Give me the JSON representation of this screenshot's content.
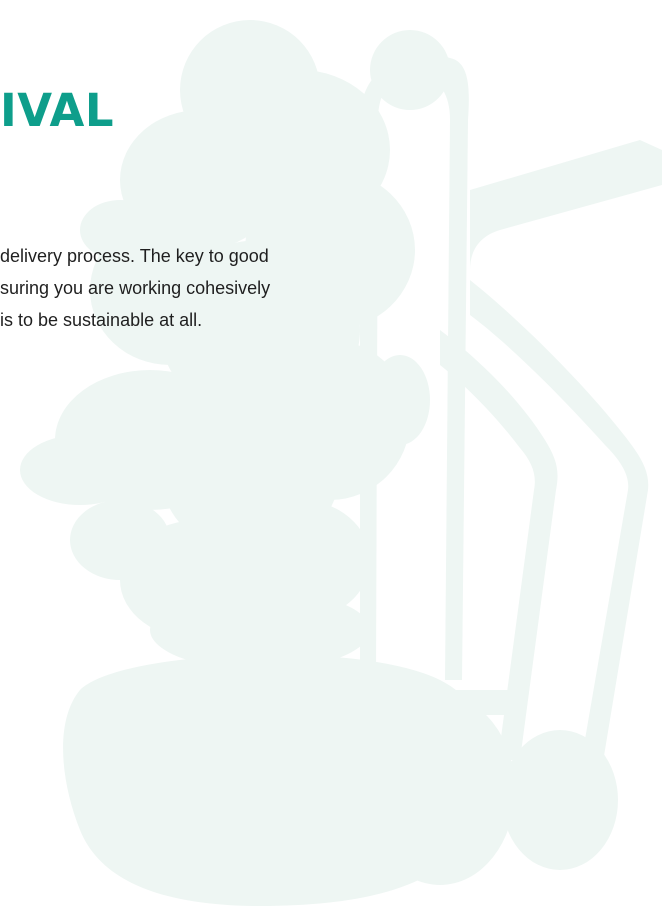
{
  "colors": {
    "title": "#0e9e8b",
    "illustration": "#eef6f3",
    "text": "#1f1f1f",
    "background": "#ffffff"
  },
  "heading": {
    "text": "IVAL"
  },
  "body": {
    "lines": [
      "delivery process. The key to good",
      "suring you are working cohesively",
      "is to be sustainable at all."
    ]
  },
  "illustration": {
    "name": "plant-and-hand-truck-silhouette"
  }
}
